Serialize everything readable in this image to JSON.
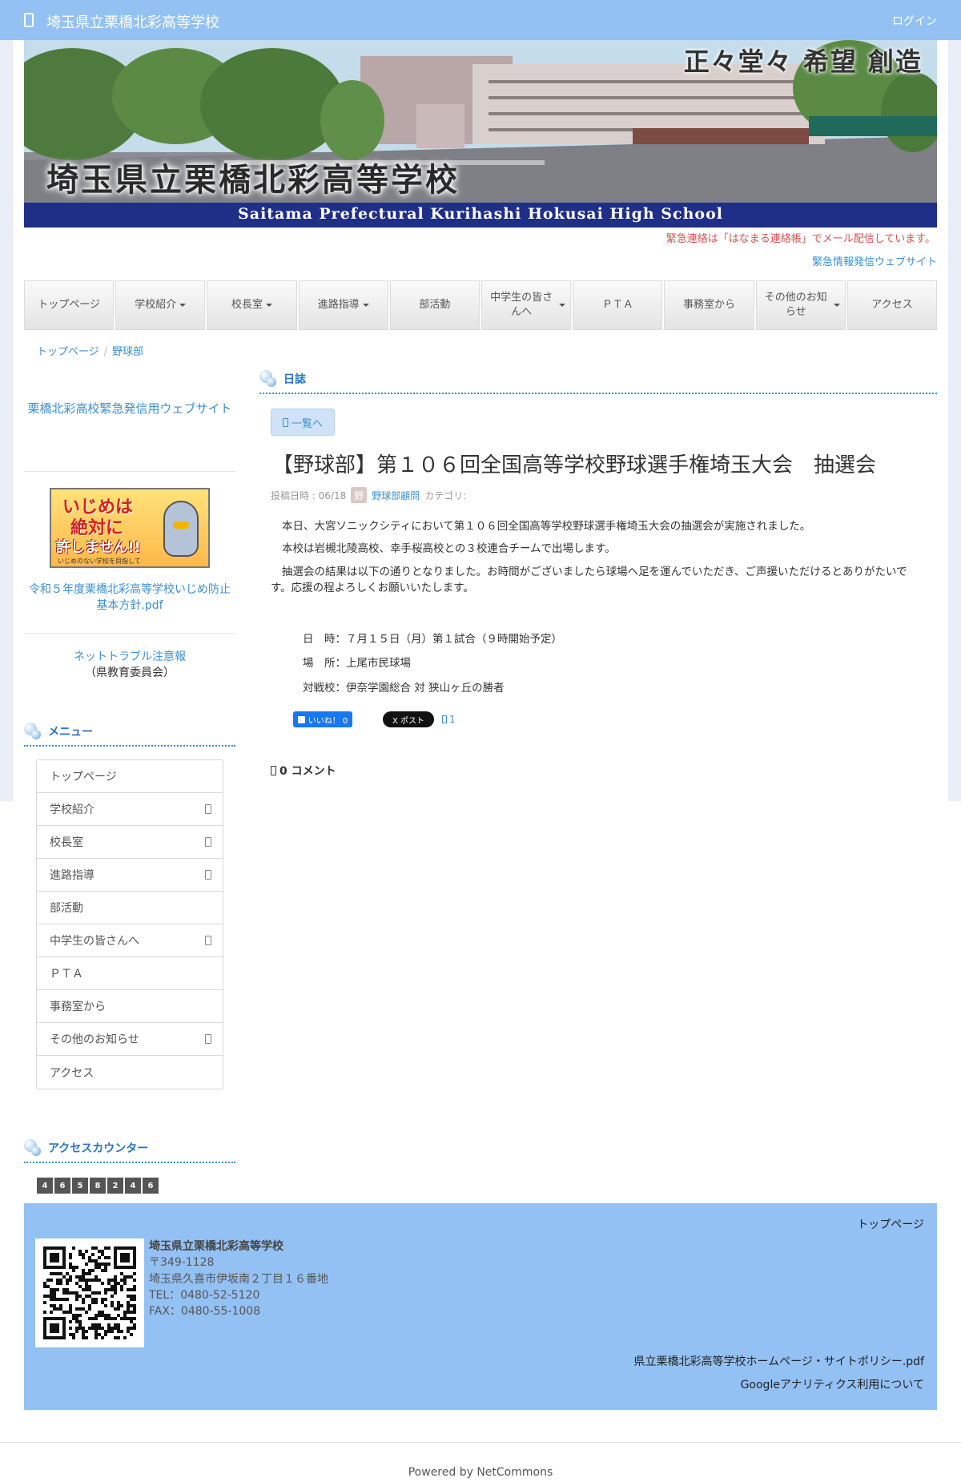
{
  "header": {
    "site_title": "埼玉県立栗橋北彩高等学校",
    "login": "ログイン"
  },
  "banner": {
    "motto": "正々堂々 希望 創造",
    "name_jp": "埼玉県立栗橋北彩高等学校",
    "name_en": "Saitama Prefectural Kurihashi Hokusai High School"
  },
  "notices": {
    "urgent": "緊急連絡は「はなまる連絡帳」でメール配信しています。",
    "urgent_link": "緊急情報発信ウェブサイト"
  },
  "nav": [
    {
      "label": "トップページ",
      "caret": false
    },
    {
      "label": "学校紹介",
      "caret": true
    },
    {
      "label": "校長室",
      "caret": true
    },
    {
      "label": "進路指導",
      "caret": true
    },
    {
      "label": "部活動",
      "caret": false
    },
    {
      "label": "中学生の皆さんへ",
      "caret": true
    },
    {
      "label": "ＰＴＡ",
      "caret": false
    },
    {
      "label": "事務室から",
      "caret": false
    },
    {
      "label": "その他のお知らせ",
      "caret": true
    },
    {
      "label": "アクセス",
      "caret": false
    }
  ],
  "breadcrumb": {
    "home": "トップページ",
    "current": "野球部"
  },
  "sidebar": {
    "emergency_link": "栗橋北彩高校緊急発信用ウェブサイト",
    "ijime_banner": {
      "line1": "いじめは",
      "line2": "絶対に",
      "line3": "許しません!!",
      "line4": "いじめのない学校を目指して"
    },
    "ijime_pdf": "令和５年度栗橋北彩高等学校いじめ防止基本方針.pdf",
    "net_trouble": "ネットトラブル注意報",
    "net_trouble_sub": "（県教育委員会）",
    "menu_title": "メニュー",
    "menu": [
      {
        "label": "トップページ",
        "sub": false
      },
      {
        "label": "学校紹介",
        "sub": true
      },
      {
        "label": "校長室",
        "sub": true
      },
      {
        "label": "進路指導",
        "sub": true
      },
      {
        "label": "部活動",
        "sub": false
      },
      {
        "label": "中学生の皆さんへ",
        "sub": true
      },
      {
        "label": "ＰＴＡ",
        "sub": false
      },
      {
        "label": "事務室から",
        "sub": false
      },
      {
        "label": "その他のお知らせ",
        "sub": true
      },
      {
        "label": "アクセス",
        "sub": false
      }
    ],
    "counter_title": "アクセスカウンター",
    "counter_digits": [
      "4",
      "6",
      "5",
      "8",
      "2",
      "4",
      "6"
    ]
  },
  "main": {
    "section_title": "日誌",
    "back_button": "一覧へ",
    "article_title": "【野球部】第１０６回全国高等学校野球選手権埼玉大会　抽選会",
    "meta_date": "投稿日時 : 06/18",
    "meta_avatar": "野",
    "meta_author": "野球部顧問",
    "meta_category": "カテゴリ:",
    "paragraphs": [
      "本日、大宮ソニックシティにおいて第１０６回全国高等学校野球選手権埼玉大会の抽選会が実施されました。",
      "本校は岩槻北陵高校、幸手桜高校との３校連合チームで出場します。",
      "抽選会の結果は以下の通りとなりました。お時間がございましたら球場へ足を運んでいただき、ご声援いただけるとありがたいです。応援の程よろしくお願いいたします。"
    ],
    "details": [
      "日　時：７月１５日（月）第１試合（９時開始予定）",
      "場　所：上尾市民球場",
      "対戦校：伊奈学園総合 対 狭山ヶ丘の勝者"
    ],
    "fb_label": "いいね！ 0",
    "tw_label": "X ポスト",
    "share_count": "1",
    "comments": "0 コメント"
  },
  "footer": {
    "top_link": "トップページ",
    "school_name": "埼玉県立栗橋北彩高等学校",
    "postal": "〒349-1128",
    "address": "埼玉県久喜市伊坂南２丁目１６番地",
    "tel": "TEL：0480-52-5120",
    "fax": "FAX：0480-55-1008",
    "policy_link": "県立栗橋北彩高等学校ホームページ・サイトポリシー.pdf",
    "analytics_link": "Googleアナリティクス利用について",
    "powered": "Powered by NetCommons"
  }
}
